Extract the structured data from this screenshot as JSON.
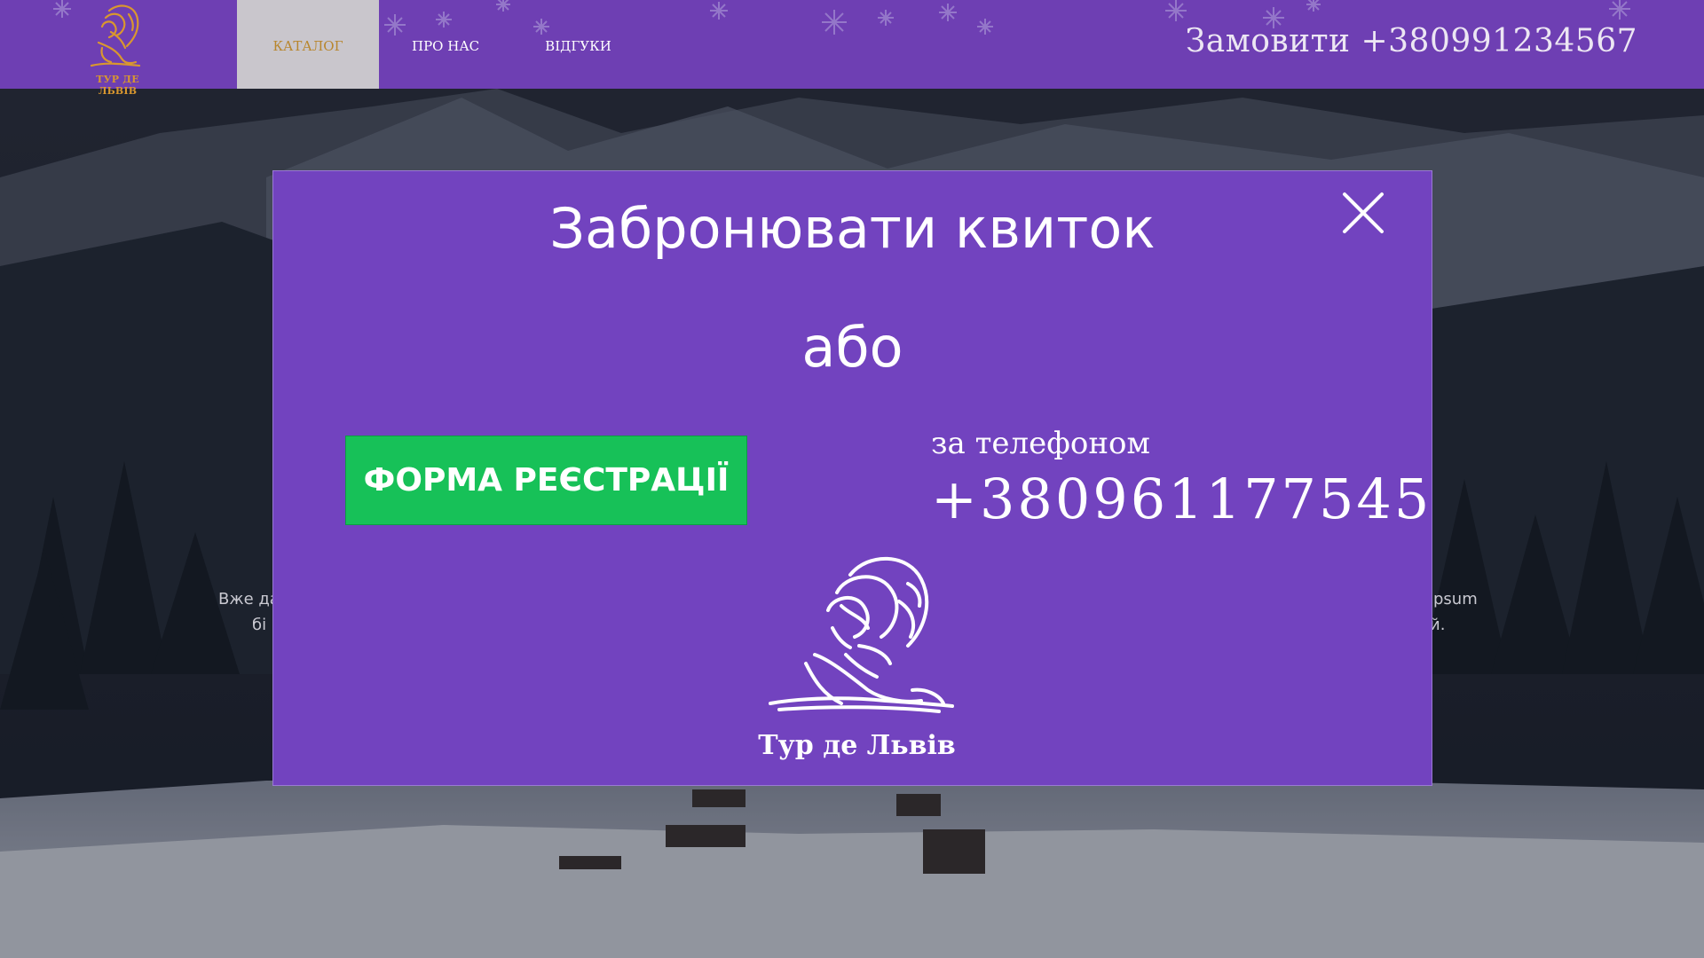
{
  "brand": {
    "logo_text": "ТУР ДЕ ЛЬВІВ",
    "accent": "#d9972f",
    "header_color": "#6e3fb3"
  },
  "nav": {
    "items": [
      {
        "label": "КАТАЛОГ",
        "active": true
      },
      {
        "label": "ПРО НАС",
        "active": false
      },
      {
        "label": "ВІДГУКИ",
        "active": false
      }
    ]
  },
  "header": {
    "order_phone": "Замовити +380991234567"
  },
  "background": {
    "text_left_1": "Вже да",
    "text_left_2": "бі",
    "text_right_1": "psum",
    "text_right_2": "й."
  },
  "modal": {
    "title": "Забронювати квиток",
    "close_icon": "close-icon",
    "or_label": "або",
    "register_button": "ФОРМА РЕЄСТРАЦІЇ",
    "phone_caption": "за телефоном",
    "phone_number": "+380961177545",
    "logo_text": "Тур де Львів",
    "background_color": "#7243bf",
    "button_color": "#17c158"
  }
}
